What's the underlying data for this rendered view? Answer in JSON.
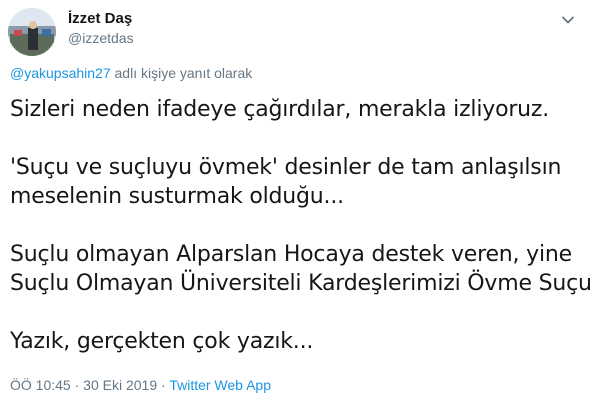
{
  "author": {
    "name": "İzzet Daş",
    "handle": "@izzetdas"
  },
  "reply": {
    "mention": "@yakupsahin27",
    "suffix": " adlı kişiye yanıt olarak"
  },
  "body": {
    "line1": "Sizleri neden ifadeye çağırdılar, merakla izliyoruz.",
    "line2": "'Suçu ve suçluyu övmek' desinler de tam anlaşılsın",
    "line3": "meselenin susturmak olduğu...",
    "line4": "Suçlu olmayan Alparslan Hocaya destek veren, yine",
    "line5": "Suçlu Olmayan Üniversiteli Kardeşlerimizi Övme Suçu...",
    "line6": "Yazık, gerçekten çok yazık..."
  },
  "meta": {
    "time": "ÖÖ 10:45",
    "separator1": " · ",
    "date": "30 Eki 2019",
    "separator2": " · ",
    "source": "Twitter Web App"
  },
  "icons": {
    "menu": "chevron-down-icon"
  },
  "colors": {
    "text": "#14171a",
    "muted": "#657786",
    "link": "#1b95e0"
  }
}
